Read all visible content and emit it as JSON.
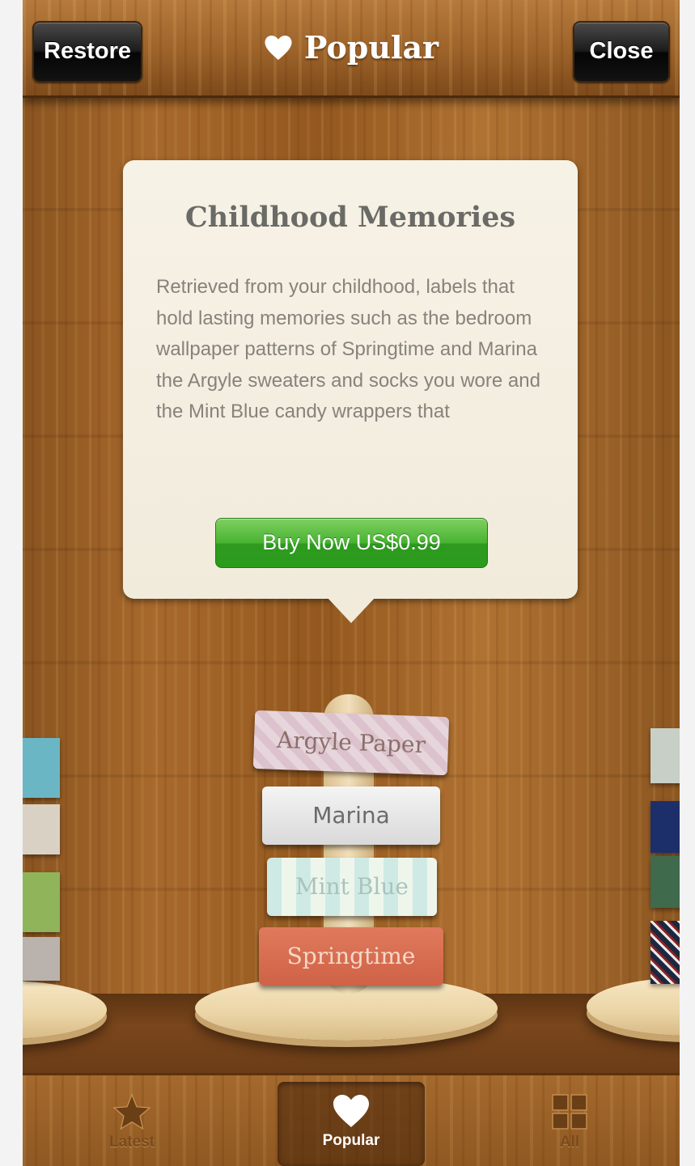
{
  "header": {
    "restore_label": "Restore",
    "title": "Popular",
    "title_icon": "heart-icon",
    "close_label": "Close"
  },
  "popover": {
    "title": "Childhood Memories",
    "description": "Retrieved from your childhood, labels that hold lasting memories such as the bedroom wallpaper patterns of Springtime and Marina the Argyle sweaters and socks you wore and the Mint Blue candy wrappers that",
    "buy_label": "Buy Now US$0.99"
  },
  "stack": {
    "labels": [
      "Argyle Paper",
      "Marina",
      "Mint Blue",
      "Springtime"
    ]
  },
  "tabbar": {
    "tabs": [
      {
        "label": "Latest",
        "icon": "star-icon",
        "active": false
      },
      {
        "label": "Popular",
        "icon": "heart-icon",
        "active": true
      },
      {
        "label": "All",
        "icon": "grid-icon",
        "active": false
      }
    ]
  },
  "colors": {
    "buy_green": "#48b332",
    "wood": "#a8692c",
    "popover_bg": "#f3eddf"
  }
}
